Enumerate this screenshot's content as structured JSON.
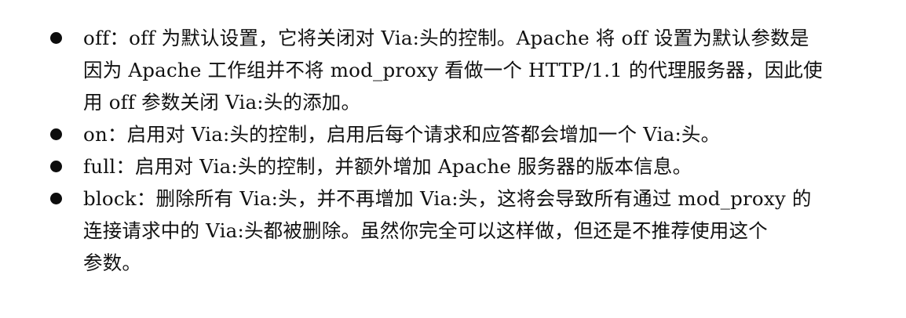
{
  "items": [
    {
      "lines": [
        "off：off 为默认设置，它将关闭对 Via:头的控制。Apache 将 off 设置为默认参数是",
        "因为 Apache 工作组并不将 mod_proxy 看做一个 HTTP/1.1 的代理服务器，因此使",
        "用 off 参数关闭 Via:头的添加。"
      ]
    },
    {
      "lines": [
        "on：启用对 Via:头的控制，启用后每个请求和应答都会增加一个 Via:头。"
      ]
    },
    {
      "lines": [
        "full：启用对 Via:头的控制，并额外增加 Apache 服务器的版本信息。"
      ]
    },
    {
      "lines": [
        "block：删除所有 Via:头，并不再增加 Via:头，这将会导致所有通过 mod_proxy 的",
        "连接请求中的 Via:头都被删除。虽然你完全可以这样做，但还是不推荐使用这个",
        "参数。"
      ]
    }
  ]
}
